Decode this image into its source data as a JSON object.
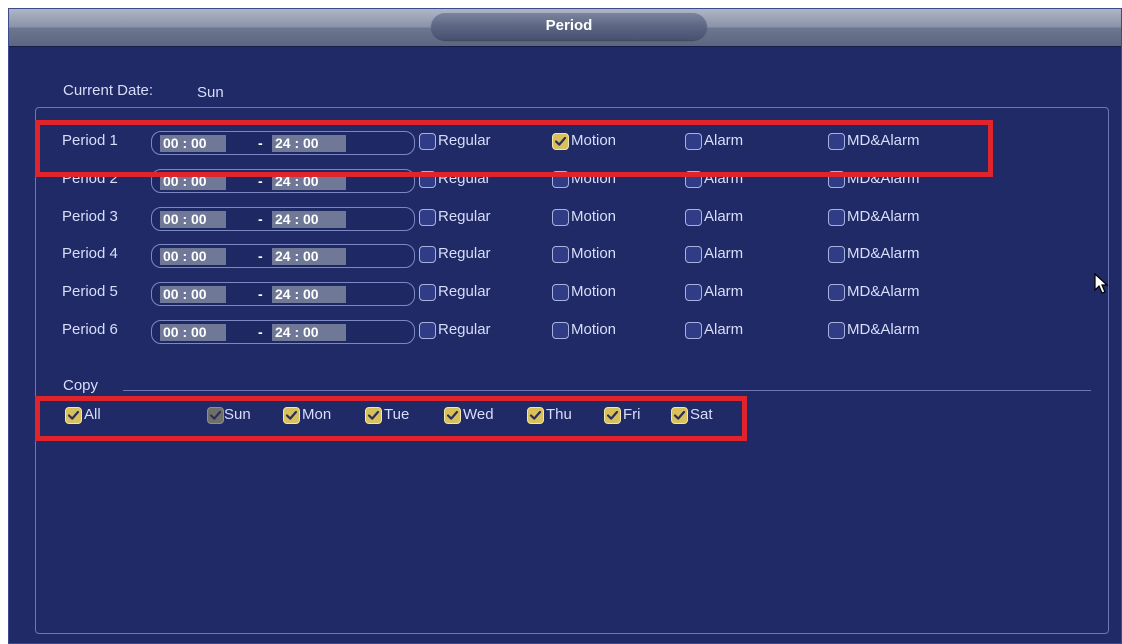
{
  "dialog": {
    "title": "Period"
  },
  "current_date": {
    "label": "Current Date:",
    "value": "Sun"
  },
  "time_separator": "-",
  "periods": [
    {
      "label": "Period 1",
      "start": "00 : 00",
      "end": "24 : 00",
      "regular": false,
      "motion": true,
      "alarm": false,
      "md_alarm": false
    },
    {
      "label": "Period 2",
      "start": "00 : 00",
      "end": "24 : 00",
      "regular": false,
      "motion": false,
      "alarm": false,
      "md_alarm": false
    },
    {
      "label": "Period 3",
      "start": "00 : 00",
      "end": "24 : 00",
      "regular": false,
      "motion": false,
      "alarm": false,
      "md_alarm": false
    },
    {
      "label": "Period 4",
      "start": "00 : 00",
      "end": "24 : 00",
      "regular": false,
      "motion": false,
      "alarm": false,
      "md_alarm": false
    },
    {
      "label": "Period 5",
      "start": "00 : 00",
      "end": "24 : 00",
      "regular": false,
      "motion": false,
      "alarm": false,
      "md_alarm": false
    },
    {
      "label": "Period 6",
      "start": "00 : 00",
      "end": "24 : 00",
      "regular": false,
      "motion": false,
      "alarm": false,
      "md_alarm": false
    }
  ],
  "record_types": {
    "regular": "Regular",
    "motion": "Motion",
    "alarm": "Alarm",
    "md_alarm": "MD&Alarm"
  },
  "copy": {
    "label": "Copy",
    "all": {
      "label": "All",
      "checked": true
    },
    "days": [
      {
        "label": "Sun",
        "checked": true,
        "disabled": true
      },
      {
        "label": "Mon",
        "checked": true,
        "disabled": false
      },
      {
        "label": "Tue",
        "checked": true,
        "disabled": false
      },
      {
        "label": "Wed",
        "checked": true,
        "disabled": false
      },
      {
        "label": "Thu",
        "checked": true,
        "disabled": false
      },
      {
        "label": "Fri",
        "checked": true,
        "disabled": false
      },
      {
        "label": "Sat",
        "checked": true,
        "disabled": false
      }
    ]
  },
  "colors": {
    "background": "#202a66",
    "check_accent": "#d8c05c",
    "highlight_box": "#e0242c",
    "text": "#d8defa"
  }
}
